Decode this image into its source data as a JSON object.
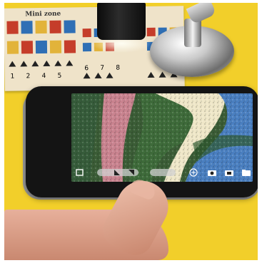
{
  "paper": {
    "title": "Mini zone",
    "row_labels": [
      "1",
      "2",
      "4",
      "5",
      "6",
      "7",
      "8"
    ]
  },
  "screen": {
    "toolbar_icons": [
      "gallery-icon",
      "flip-horizontal-icon",
      "flip-vertical-icon",
      "zoom-slider",
      "add-icon",
      "camera-icon",
      "video-icon",
      "folder-icon"
    ]
  },
  "colors": {
    "background_table": "#f2cf2a",
    "paper": "#efe3c9",
    "phone_body": "#141414",
    "magnified_green": "#3e6b3a",
    "magnified_pink": "#c9838f",
    "magnified_cream": "#efe7c8",
    "magnified_blue": "#4a7fc0"
  }
}
